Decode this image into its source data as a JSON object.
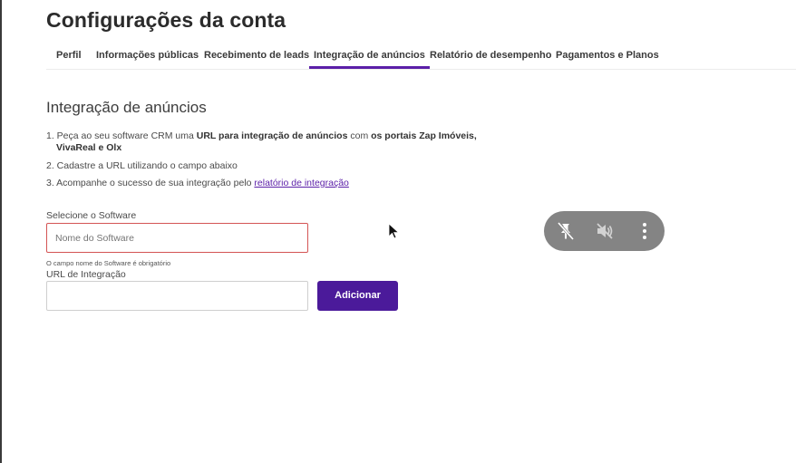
{
  "page": {
    "title": "Configurações da conta"
  },
  "tabs": [
    {
      "label": "Perfil"
    },
    {
      "label": "Informações públicas"
    },
    {
      "label": "Recebimento de leads"
    },
    {
      "label": "Integração de anúncios"
    },
    {
      "label": "Relatório de desempenho"
    },
    {
      "label": "Pagamentos e Planos"
    }
  ],
  "active_tab": "Integração de anúncios",
  "section": {
    "title": "Integração de anúncios",
    "steps": {
      "s1_prefix": "1. Peça ao seu software CRM uma ",
      "s1_bold1": "URL para integração de anúncios",
      "s1_mid": " com ",
      "s1_bold2": "os portais Zap Imóveis,",
      "s1_bold3": "VivaReal e Olx",
      "s2": "2. Cadastre a URL utilizando o campo abaixo",
      "s3_prefix": "3. Acompanhe o sucesso de sua integração pelo ",
      "s3_link": "relatório de integração"
    }
  },
  "form": {
    "software_label": "Selecione o Software",
    "software_placeholder": "Nome do Software",
    "software_value": "",
    "software_error": "O campo nome do Software é obrigatório",
    "url_label": "URL de Integração",
    "url_value": "",
    "add_button": "Adicionar"
  },
  "colors": {
    "accent": "#5b1fa8",
    "button": "#4b1a9a",
    "error_border": "#d45454",
    "overlay": "#7a7a7a"
  },
  "overlay": {
    "icons": [
      "unpin-icon",
      "mute-icon",
      "more-vert-icon"
    ]
  }
}
